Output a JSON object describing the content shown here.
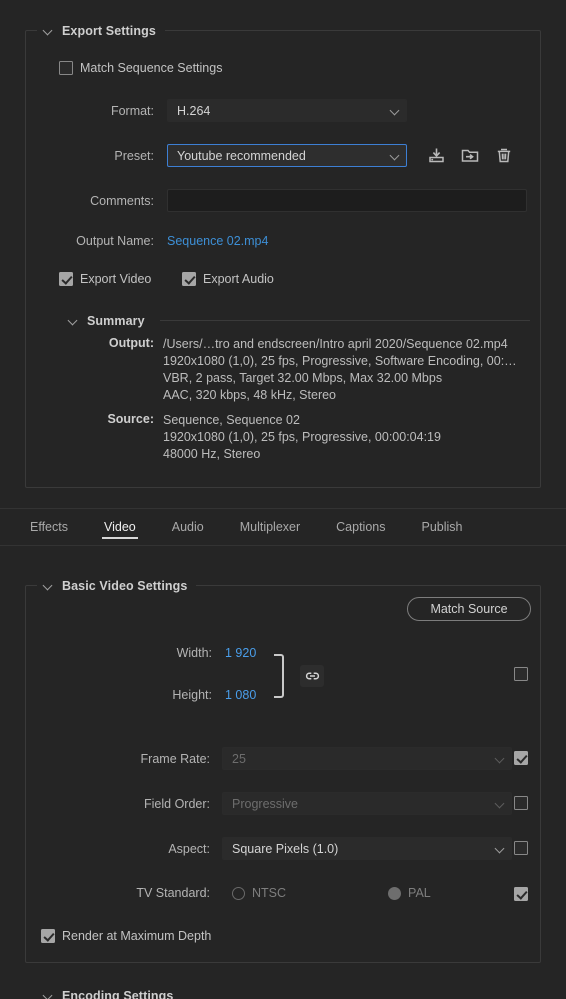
{
  "export_settings": {
    "title": "Export Settings",
    "match_sequence": {
      "label": "Match Sequence Settings",
      "checked": false
    },
    "format": {
      "label": "Format:",
      "value": "H.264"
    },
    "preset": {
      "label": "Preset:",
      "value": "Youtube recommended"
    },
    "preset_actions": {
      "save": "save-preset-icon",
      "import": "import-preset-icon",
      "delete": "delete-preset-icon"
    },
    "comments": {
      "label": "Comments:",
      "value": "",
      "placeholder": ""
    },
    "output_name": {
      "label": "Output Name:",
      "value": "Sequence 02.mp4"
    },
    "export_video": {
      "label": "Export Video",
      "checked": true
    },
    "export_audio": {
      "label": "Export Audio",
      "checked": true
    },
    "summary": {
      "title": "Summary",
      "output_label": "Output:",
      "output_lines": [
        "/Users/…tro and endscreen/Intro april 2020/Sequence 02.mp4",
        "1920x1080 (1,0), 25 fps, Progressive, Software Encoding, 00:…",
        "VBR, 2 pass, Target 32.00 Mbps, Max 32.00 Mbps",
        "AAC, 320 kbps, 48 kHz, Stereo"
      ],
      "source_label": "Source:",
      "source_lines": [
        "Sequence, Sequence 02",
        "1920x1080 (1,0), 25 fps, Progressive, 00:00:04:19",
        "48000 Hz, Stereo"
      ]
    }
  },
  "tabs": [
    {
      "label": "Effects",
      "active": false
    },
    {
      "label": "Video",
      "active": true
    },
    {
      "label": "Audio",
      "active": false
    },
    {
      "label": "Multiplexer",
      "active": false
    },
    {
      "label": "Captions",
      "active": false
    },
    {
      "label": "Publish",
      "active": false
    }
  ],
  "basic_video": {
    "title": "Basic Video Settings",
    "match_source_button": "Match Source",
    "width": {
      "label": "Width:",
      "value": "1 920"
    },
    "height": {
      "label": "Height:",
      "value": "1 080"
    },
    "link_icon": "link-chain-icon",
    "dimensions_checkbox": {
      "checked": false
    },
    "frame_rate": {
      "label": "Frame Rate:",
      "value": "25",
      "disabled": true,
      "checked": true
    },
    "field_order": {
      "label": "Field Order:",
      "value": "Progressive",
      "disabled": true,
      "checked": false
    },
    "aspect": {
      "label": "Aspect:",
      "value": "Square Pixels (1.0)",
      "disabled": false,
      "checked": false
    },
    "tv_standard": {
      "label": "TV Standard:",
      "options": [
        {
          "label": "NTSC",
          "selected": false
        },
        {
          "label": "PAL",
          "selected": true
        }
      ],
      "checked": true
    },
    "render_max_depth": {
      "label": "Render at Maximum Depth",
      "checked": true
    }
  },
  "encoding_settings": {
    "title": "Encoding Settings"
  },
  "colors": {
    "background": "#252525",
    "accent_link": "#3d8fd6",
    "value_blue": "#4a9eea",
    "focus_border": "#3d7fd4"
  }
}
